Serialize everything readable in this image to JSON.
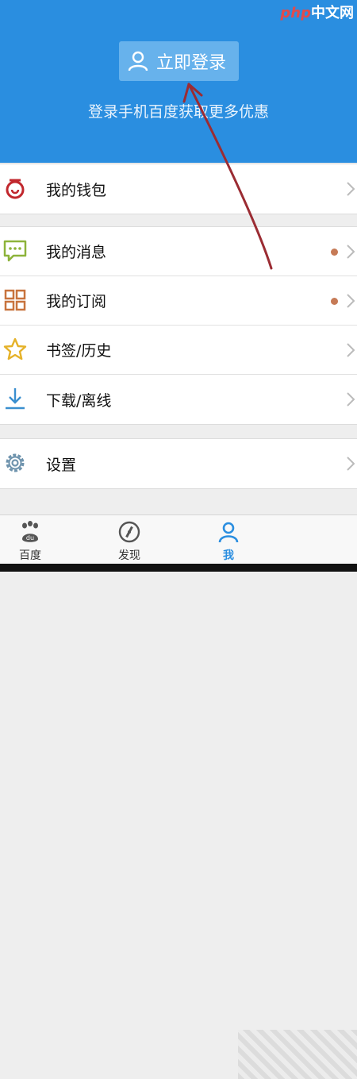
{
  "watermark": {
    "php": "php",
    "cn": "中文网"
  },
  "header": {
    "login_label": "立即登录",
    "subtitle": "登录手机百度获取更多优惠"
  },
  "groups": [
    {
      "items": [
        {
          "label": "我的钱包",
          "icon": "wallet-icon",
          "dot": false
        }
      ]
    },
    {
      "items": [
        {
          "label": "我的消息",
          "icon": "message-icon",
          "dot": true
        },
        {
          "label": "我的订阅",
          "icon": "grid-icon",
          "dot": true
        },
        {
          "label": "书签/历史",
          "icon": "star-icon",
          "dot": false
        },
        {
          "label": "下载/离线",
          "icon": "download-icon",
          "dot": false
        }
      ]
    },
    {
      "items": [
        {
          "label": "设置",
          "icon": "gear-icon",
          "dot": false
        }
      ]
    }
  ],
  "tabs": [
    {
      "label": "百度",
      "icon": "baidu-paw-icon",
      "active": false
    },
    {
      "label": "发现",
      "icon": "compass-icon",
      "active": false
    },
    {
      "label": "我",
      "icon": "user-icon",
      "active": true
    }
  ],
  "colors": {
    "header_blue": "#2a8ee0",
    "login_button": "#67b2ec",
    "badge_dot": "#c67a56",
    "arrow": "#9b2c33"
  }
}
